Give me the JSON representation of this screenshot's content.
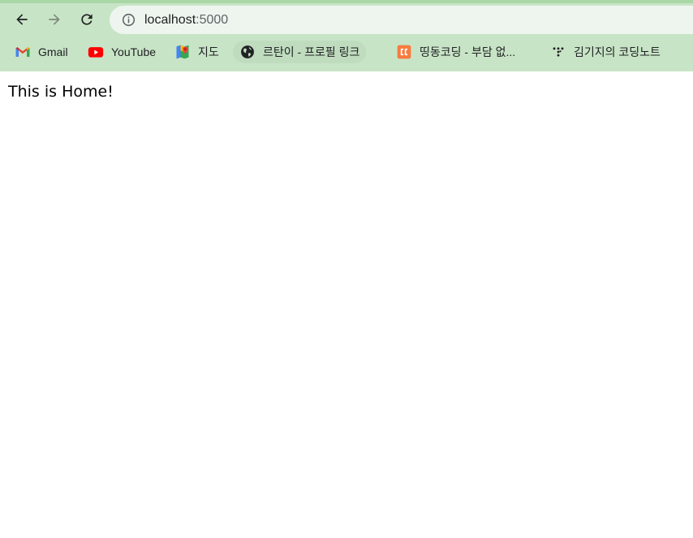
{
  "browser": {
    "url_host": "localhost",
    "url_port": ":5000"
  },
  "bookmarks": [
    {
      "label": "Gmail",
      "icon": "gmail-icon"
    },
    {
      "label": "YouTube",
      "icon": "youtube-icon"
    },
    {
      "label": "지도",
      "icon": "maps-icon"
    },
    {
      "label": "르탄이 - 프로필 링크",
      "icon": "globe-icon"
    },
    {
      "label": "띵동코딩 - 부담 없...",
      "icon": "dingdong-icon"
    },
    {
      "label": "김기지의 코딩노트",
      "icon": "dots-icon"
    }
  ],
  "page": {
    "text": "This is Home!"
  },
  "colors": {
    "toolbar_bg": "#c8e4c6",
    "omnibox_bg": "#eef5ee"
  }
}
